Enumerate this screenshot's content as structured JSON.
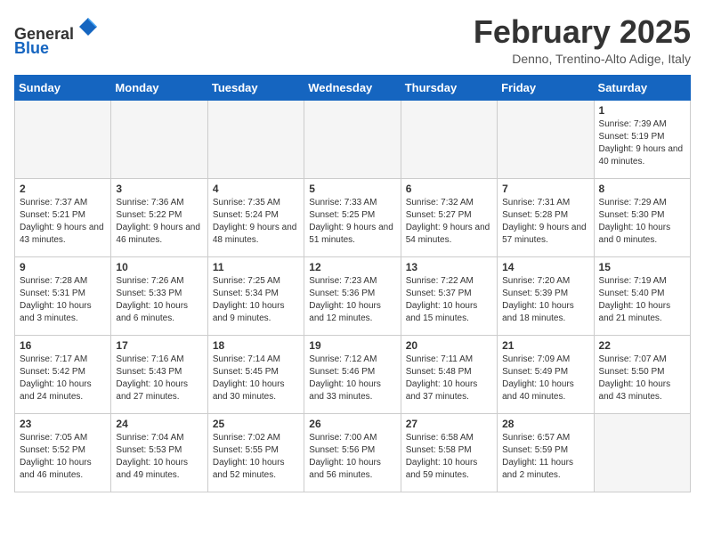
{
  "header": {
    "logo_line1": "General",
    "logo_line2": "Blue",
    "month": "February 2025",
    "location": "Denno, Trentino-Alto Adige, Italy"
  },
  "weekdays": [
    "Sunday",
    "Monday",
    "Tuesday",
    "Wednesday",
    "Thursday",
    "Friday",
    "Saturday"
  ],
  "weeks": [
    [
      {
        "day": "",
        "info": ""
      },
      {
        "day": "",
        "info": ""
      },
      {
        "day": "",
        "info": ""
      },
      {
        "day": "",
        "info": ""
      },
      {
        "day": "",
        "info": ""
      },
      {
        "day": "",
        "info": ""
      },
      {
        "day": "1",
        "info": "Sunrise: 7:39 AM\nSunset: 5:19 PM\nDaylight: 9 hours and 40 minutes."
      }
    ],
    [
      {
        "day": "2",
        "info": "Sunrise: 7:37 AM\nSunset: 5:21 PM\nDaylight: 9 hours and 43 minutes."
      },
      {
        "day": "3",
        "info": "Sunrise: 7:36 AM\nSunset: 5:22 PM\nDaylight: 9 hours and 46 minutes."
      },
      {
        "day": "4",
        "info": "Sunrise: 7:35 AM\nSunset: 5:24 PM\nDaylight: 9 hours and 48 minutes."
      },
      {
        "day": "5",
        "info": "Sunrise: 7:33 AM\nSunset: 5:25 PM\nDaylight: 9 hours and 51 minutes."
      },
      {
        "day": "6",
        "info": "Sunrise: 7:32 AM\nSunset: 5:27 PM\nDaylight: 9 hours and 54 minutes."
      },
      {
        "day": "7",
        "info": "Sunrise: 7:31 AM\nSunset: 5:28 PM\nDaylight: 9 hours and 57 minutes."
      },
      {
        "day": "8",
        "info": "Sunrise: 7:29 AM\nSunset: 5:30 PM\nDaylight: 10 hours and 0 minutes."
      }
    ],
    [
      {
        "day": "9",
        "info": "Sunrise: 7:28 AM\nSunset: 5:31 PM\nDaylight: 10 hours and 3 minutes."
      },
      {
        "day": "10",
        "info": "Sunrise: 7:26 AM\nSunset: 5:33 PM\nDaylight: 10 hours and 6 minutes."
      },
      {
        "day": "11",
        "info": "Sunrise: 7:25 AM\nSunset: 5:34 PM\nDaylight: 10 hours and 9 minutes."
      },
      {
        "day": "12",
        "info": "Sunrise: 7:23 AM\nSunset: 5:36 PM\nDaylight: 10 hours and 12 minutes."
      },
      {
        "day": "13",
        "info": "Sunrise: 7:22 AM\nSunset: 5:37 PM\nDaylight: 10 hours and 15 minutes."
      },
      {
        "day": "14",
        "info": "Sunrise: 7:20 AM\nSunset: 5:39 PM\nDaylight: 10 hours and 18 minutes."
      },
      {
        "day": "15",
        "info": "Sunrise: 7:19 AM\nSunset: 5:40 PM\nDaylight: 10 hours and 21 minutes."
      }
    ],
    [
      {
        "day": "16",
        "info": "Sunrise: 7:17 AM\nSunset: 5:42 PM\nDaylight: 10 hours and 24 minutes."
      },
      {
        "day": "17",
        "info": "Sunrise: 7:16 AM\nSunset: 5:43 PM\nDaylight: 10 hours and 27 minutes."
      },
      {
        "day": "18",
        "info": "Sunrise: 7:14 AM\nSunset: 5:45 PM\nDaylight: 10 hours and 30 minutes."
      },
      {
        "day": "19",
        "info": "Sunrise: 7:12 AM\nSunset: 5:46 PM\nDaylight: 10 hours and 33 minutes."
      },
      {
        "day": "20",
        "info": "Sunrise: 7:11 AM\nSunset: 5:48 PM\nDaylight: 10 hours and 37 minutes."
      },
      {
        "day": "21",
        "info": "Sunrise: 7:09 AM\nSunset: 5:49 PM\nDaylight: 10 hours and 40 minutes."
      },
      {
        "day": "22",
        "info": "Sunrise: 7:07 AM\nSunset: 5:50 PM\nDaylight: 10 hours and 43 minutes."
      }
    ],
    [
      {
        "day": "23",
        "info": "Sunrise: 7:05 AM\nSunset: 5:52 PM\nDaylight: 10 hours and 46 minutes."
      },
      {
        "day": "24",
        "info": "Sunrise: 7:04 AM\nSunset: 5:53 PM\nDaylight: 10 hours and 49 minutes."
      },
      {
        "day": "25",
        "info": "Sunrise: 7:02 AM\nSunset: 5:55 PM\nDaylight: 10 hours and 52 minutes."
      },
      {
        "day": "26",
        "info": "Sunrise: 7:00 AM\nSunset: 5:56 PM\nDaylight: 10 hours and 56 minutes."
      },
      {
        "day": "27",
        "info": "Sunrise: 6:58 AM\nSunset: 5:58 PM\nDaylight: 10 hours and 59 minutes."
      },
      {
        "day": "28",
        "info": "Sunrise: 6:57 AM\nSunset: 5:59 PM\nDaylight: 11 hours and 2 minutes."
      },
      {
        "day": "",
        "info": ""
      }
    ]
  ]
}
